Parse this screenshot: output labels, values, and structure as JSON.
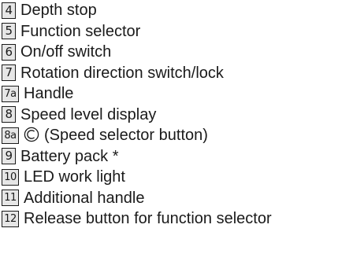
{
  "legend": {
    "items": [
      {
        "number": "4",
        "label": "Depth stop"
      },
      {
        "number": "5",
        "label": "Function selector"
      },
      {
        "number": "6",
        "label": "On/off switch"
      },
      {
        "number": "7",
        "label": "Rotation direction switch/lock"
      },
      {
        "number": "7a",
        "label": "Handle"
      },
      {
        "number": "8",
        "label": "Speed level display"
      },
      {
        "number": "8a",
        "icon": "speed-selector-icon",
        "label": "(Speed selector button)"
      },
      {
        "number": "9",
        "label": "Battery pack *"
      },
      {
        "number": "10",
        "label": "LED work light"
      },
      {
        "number": "11",
        "label": "Additional handle"
      },
      {
        "number": "12",
        "label": "Release button for function selector"
      }
    ]
  }
}
